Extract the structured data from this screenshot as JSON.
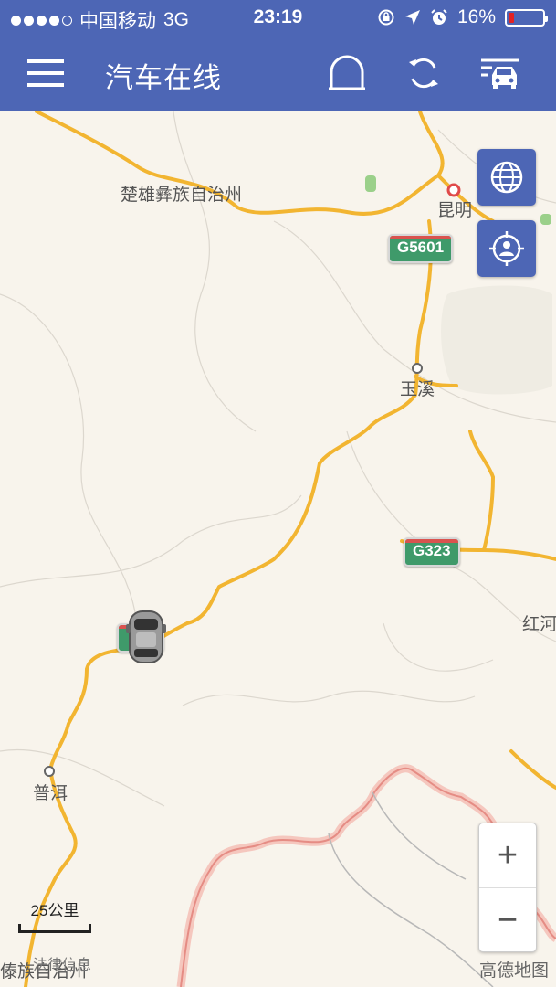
{
  "status_bar": {
    "carrier": "中国移动",
    "network": "3G",
    "time": "23:19",
    "battery": "16%",
    "battery_level": 0.16,
    "signal_bars_filled": 4,
    "signal_bars_total": 5
  },
  "nav": {
    "title": "汽车在线",
    "icons": [
      "menu-icon",
      "tunnel-icon",
      "refresh-icon",
      "traffic-car-icon"
    ]
  },
  "map": {
    "places": {
      "chuxiong": "楚雄彝族自治州",
      "kunming": "昆明",
      "yuxi": "玉溪",
      "puer": "普洱",
      "honghe": "红河",
      "bottom_left": "傣族自治州",
      "bottom_partial": "法律信息"
    },
    "road_shields": {
      "g5601": "G5601",
      "g323": "G323"
    },
    "scale_label": "25公里",
    "zoom_in": "+",
    "zoom_out": "−",
    "provider": "高德地图",
    "colors": {
      "nav": "#4d66b5",
      "road": "#f2b531",
      "border": "#f4a8a0",
      "shield": "#3f9a6a"
    }
  }
}
